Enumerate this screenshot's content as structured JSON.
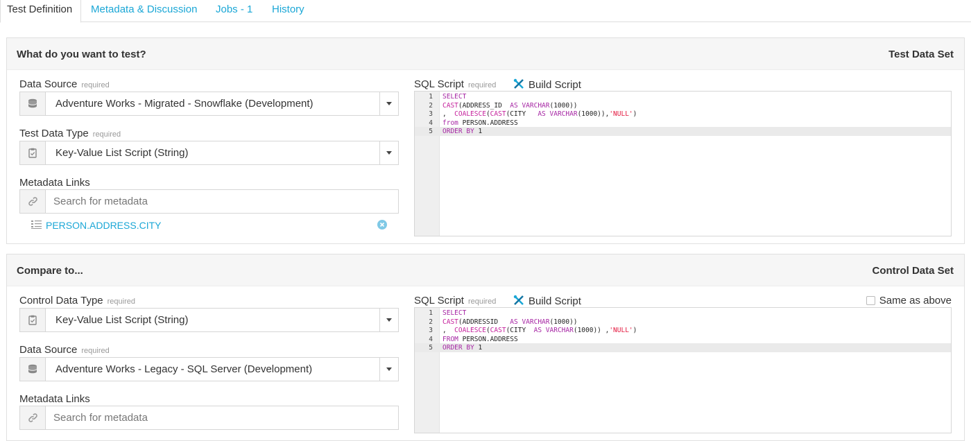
{
  "tabs": [
    {
      "label": "Test Definition",
      "active": true
    },
    {
      "label": "Metadata & Discussion"
    },
    {
      "label": "Jobs - 1"
    },
    {
      "label": "History"
    }
  ],
  "required_text": "required",
  "build_script_label": "Build Script",
  "sql_script_label": "SQL Script",
  "accent_color": "#1ba7d6",
  "test_panel": {
    "title": "What do you want to test?",
    "right_label": "Test Data Set",
    "data_source": {
      "label": "Data Source",
      "value": "Adventure Works - Migrated - Snowflake (Development)"
    },
    "data_type": {
      "label": "Test Data Type",
      "value": "Key-Value List Script (String)"
    },
    "metadata": {
      "label": "Metadata Links",
      "placeholder": "Search for metadata",
      "link": "PERSON.ADDRESS.CITY"
    },
    "code": [
      {
        "n": "1",
        "parts": [
          {
            "t": "SELECT",
            "c": "kw"
          }
        ]
      },
      {
        "n": "2",
        "parts": [
          {
            "t": "CAST",
            "c": "fn"
          },
          {
            "t": "(ADDRESS_ID  ",
            "c": "plain"
          },
          {
            "t": "AS",
            "c": "kw"
          },
          {
            "t": " ",
            "c": "plain"
          },
          {
            "t": "VARCHAR",
            "c": "ty"
          },
          {
            "t": "(1000))",
            "c": "plain"
          }
        ]
      },
      {
        "n": "3",
        "parts": [
          {
            "t": ",  ",
            "c": "plain"
          },
          {
            "t": "COALESCE",
            "c": "fn"
          },
          {
            "t": "(",
            "c": "plain"
          },
          {
            "t": "CAST",
            "c": "fn"
          },
          {
            "t": "(CITY   ",
            "c": "plain"
          },
          {
            "t": "AS",
            "c": "kw"
          },
          {
            "t": " ",
            "c": "plain"
          },
          {
            "t": "VARCHAR",
            "c": "ty"
          },
          {
            "t": "(1000)),",
            "c": "plain"
          },
          {
            "t": "'NULL'",
            "c": "str"
          },
          {
            "t": ")",
            "c": "plain"
          }
        ]
      },
      {
        "n": "4",
        "parts": [
          {
            "t": "from",
            "c": "kw"
          },
          {
            "t": " PERSON.ADDRESS",
            "c": "plain"
          }
        ]
      },
      {
        "n": "5",
        "parts": [
          {
            "t": "ORDER BY",
            "c": "kw"
          },
          {
            "t": " 1",
            "c": "plain"
          }
        ],
        "current": true
      }
    ]
  },
  "control_panel": {
    "title": "Compare to...",
    "right_label": "Control Data Set",
    "data_type": {
      "label": "Control Data Type",
      "value": "Key-Value List Script (String)"
    },
    "data_source": {
      "label": "Data Source",
      "value": "Adventure Works - Legacy - SQL Server (Development)"
    },
    "metadata": {
      "label": "Metadata Links",
      "placeholder": "Search for metadata"
    },
    "same_as_above": "Same as above",
    "code": [
      {
        "n": "1",
        "parts": [
          {
            "t": "SELECT",
            "c": "kw"
          }
        ]
      },
      {
        "n": "2",
        "parts": [
          {
            "t": "CAST",
            "c": "fn"
          },
          {
            "t": "(ADDRESSID   ",
            "c": "plain"
          },
          {
            "t": "AS",
            "c": "kw"
          },
          {
            "t": " ",
            "c": "plain"
          },
          {
            "t": "VARCHAR",
            "c": "ty"
          },
          {
            "t": "(1000))",
            "c": "plain"
          }
        ]
      },
      {
        "n": "3",
        "parts": [
          {
            "t": ",  ",
            "c": "plain"
          },
          {
            "t": "COALESCE",
            "c": "fn"
          },
          {
            "t": "(",
            "c": "plain"
          },
          {
            "t": "CAST",
            "c": "fn"
          },
          {
            "t": "(CITY  ",
            "c": "plain"
          },
          {
            "t": "AS",
            "c": "kw"
          },
          {
            "t": " ",
            "c": "plain"
          },
          {
            "t": "VARCHAR",
            "c": "ty"
          },
          {
            "t": "(1000)) ,",
            "c": "plain"
          },
          {
            "t": "'NULL'",
            "c": "str"
          },
          {
            "t": ")",
            "c": "plain"
          }
        ]
      },
      {
        "n": "4",
        "parts": [
          {
            "t": "FROM",
            "c": "kw"
          },
          {
            "t": " PERSON.ADDRESS",
            "c": "plain"
          }
        ]
      },
      {
        "n": "5",
        "parts": [
          {
            "t": "ORDER BY",
            "c": "kw"
          },
          {
            "t": " 1",
            "c": "plain"
          }
        ],
        "current": true
      }
    ]
  }
}
